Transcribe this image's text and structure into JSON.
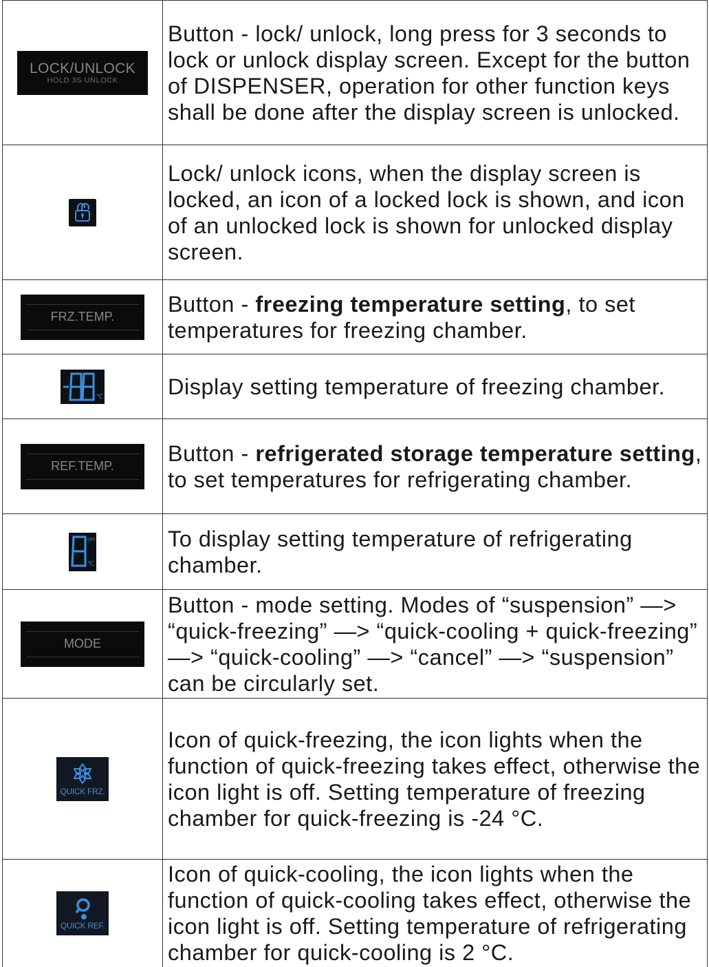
{
  "rows": [
    {
      "visual": {
        "type": "button",
        "main": "LOCK/UNLOCK",
        "sub": "HOLD 3S UNLOCK"
      },
      "icon": "lock-unlock-button",
      "text": "Button - lock/ unlock, long press for 3 seconds to lock or unlock display screen. Except for the button of DISPENSER, operation for other function keys shall be done after the display screen is unlocked."
    },
    {
      "visual": {
        "type": "lcd"
      },
      "icon": "padlock-icon",
      "text": "Lock/ unlock icons, when the display screen is locked, an icon of a locked lock is shown, and icon of an unlocked lock is shown for unlocked display screen."
    },
    {
      "visual": {
        "type": "button",
        "main": "FRZ.TEMP."
      },
      "icon": "freezer-temp-button",
      "text_before": "Button - ",
      "text_bold": "freezing temperature setting",
      "text_after": ", to set temperatures for freezing chamber."
    },
    {
      "visual": {
        "type": "lcd"
      },
      "icon": "two-digit-display-icon",
      "text": "Display setting temperature of freezing chamber."
    },
    {
      "visual": {
        "type": "button",
        "main": "REF.TEMP."
      },
      "icon": "fridge-temp-button",
      "text_before": "Button - ",
      "text_bold": "refrigerated storage temperature setting",
      "text_after": ", to set temperatures for refrigerating chamber."
    },
    {
      "visual": {
        "type": "lcd",
        "sup": "OFF"
      },
      "icon": "one-digit-display-icon",
      "text": "To display setting temperature of refrigerating chamber."
    },
    {
      "visual": {
        "type": "button",
        "main": "MODE"
      },
      "icon": "mode-button",
      "text": "Button - mode setting. Modes of “suspension” —> “quick-freezing” —> “quick-cooling + quick-freezing” —> “quick-cooling” —> “cancel” —> “suspension” can be circularly set."
    },
    {
      "visual": {
        "type": "lcd",
        "label": "QUICK FRZ."
      },
      "icon": "snowflake-icon",
      "text": "Icon of quick-freezing, the icon lights when the function of quick-freezing takes effect, otherwise the icon light is off. Setting temperature of freezing chamber for quick-freezing is -24 °C."
    },
    {
      "visual": {
        "type": "lcd",
        "label": "QUICK REF."
      },
      "icon": "quick-cool-icon",
      "text": "Icon of quick-cooling, the icon lights when the function of quick-cooling takes effect, otherwise the icon light is off. Setting temperature of refrigerating chamber for quick-cooling is 2 °C."
    }
  ],
  "colors": {
    "lcd_blue": "#3d8fe0",
    "button_bg": "#0c0b0a",
    "button_text": "#8a8681",
    "border": "#333333"
  }
}
